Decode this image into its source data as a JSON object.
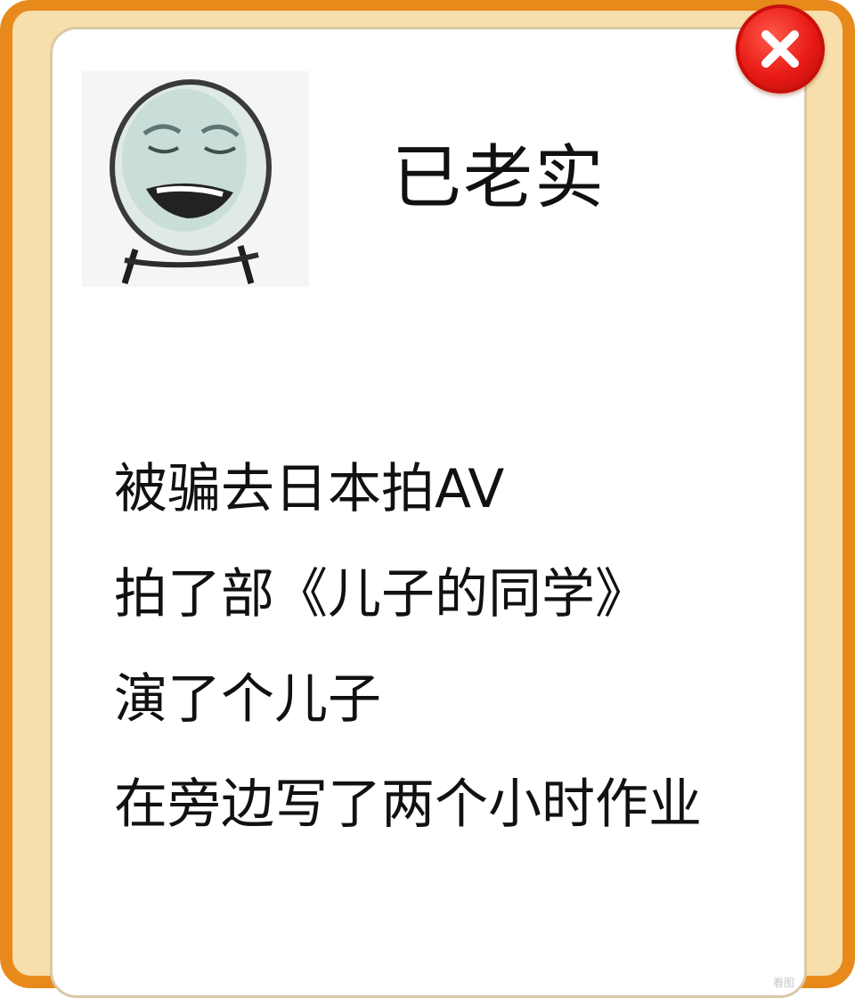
{
  "dialog": {
    "title": "已老实",
    "avatar_icon": "crying-face-meme-icon",
    "close_icon": "close-icon",
    "message_lines": [
      "被骗去日本拍AV",
      "拍了部《儿子的同学》",
      "演了个儿子",
      "在旁边写了两个小时作业"
    ]
  },
  "watermark": "看图",
  "colors": {
    "frame_border": "#e8891c",
    "frame_fill": "#f6dfab",
    "panel": "#ffffff",
    "close_button": "#e81a15",
    "text": "#111111"
  }
}
